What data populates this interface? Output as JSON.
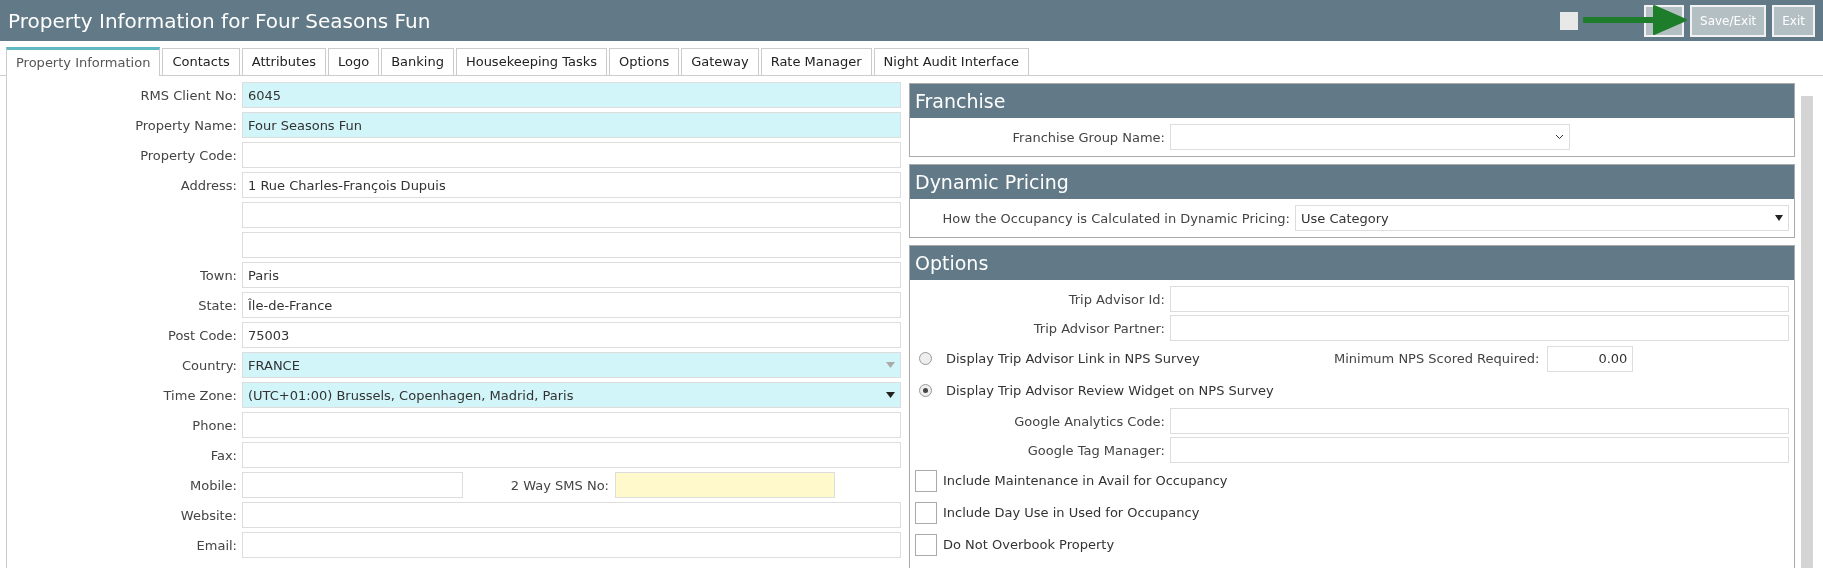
{
  "header": {
    "title": "Property Information for Four Seasons Fun",
    "inactive_checkbox": {
      "checked": false
    },
    "buttons": [
      {
        "label": "Save/Exit"
      },
      {
        "label": "Exit"
      }
    ]
  },
  "tabs": [
    {
      "label": "Property Information",
      "selected": true
    },
    {
      "label": "Contacts",
      "selected": false
    },
    {
      "label": "Attributes",
      "selected": false
    },
    {
      "label": "Logo",
      "selected": false
    },
    {
      "label": "Banking",
      "selected": false
    },
    {
      "label": "Housekeeping Tasks",
      "selected": false
    },
    {
      "label": "Options",
      "selected": false
    },
    {
      "label": "Gateway",
      "selected": false
    },
    {
      "label": "Rate Manager",
      "selected": false
    },
    {
      "label": "Night Audit Interface",
      "selected": false
    }
  ],
  "property_form": [
    {
      "label": "RMS Client No:",
      "value": "6045",
      "kind": "text",
      "color": "#d1f5f9"
    },
    {
      "label": "Property Name:",
      "value": "Four Seasons Fun",
      "kind": "text",
      "color": "#d1f5f9"
    },
    {
      "label": "Property Code:",
      "kind": "text"
    },
    {
      "label": "Address:",
      "value": "1 Rue Charles-François Dupuis",
      "kind": "text"
    },
    {
      "kind": "text"
    },
    {
      "kind": "text"
    },
    {
      "label": "Town:",
      "value": "Paris",
      "kind": "text"
    },
    {
      "label": "State:",
      "value": "Île-de-France",
      "kind": "text"
    },
    {
      "label": "Post Code:",
      "value": "75003",
      "kind": "text"
    },
    {
      "label": "Country:",
      "value": "FRANCE",
      "kind": "combo",
      "color": "#d1f5f9"
    },
    {
      "label": "Time Zone:",
      "value": "(UTC+01:00) Brussels, Copenhagen, Madrid, Paris",
      "kind": "select",
      "color": "#d1f5f9"
    },
    {
      "label": "Phone:",
      "kind": "text"
    },
    {
      "label": "Fax:",
      "kind": "text"
    },
    {
      "label": "Mobile:",
      "kind": "pair",
      "second": {
        "label": "2 Way SMS No:",
        "color": "#fff9cc"
      }
    },
    {
      "label": "Website:",
      "kind": "text"
    },
    {
      "label": "Email:",
      "kind": "text"
    }
  ],
  "franchise": {
    "title": "Franchise",
    "label": "Franchise Group Name:"
  },
  "dynamic_pricing": {
    "title": "Dynamic Pricing",
    "label": "How the Occupancy is Calculated in Dynamic Pricing:",
    "value": "Use Category"
  },
  "options": {
    "title": "Options",
    "items": [
      {
        "kind": "field",
        "label": "Trip Advisor Id:"
      },
      {
        "kind": "field",
        "label": "Trip Advisor Partner:"
      },
      {
        "kind": "radio",
        "label": "Display Trip Advisor Link in NPS Survey",
        "selected": false,
        "side_label": "Minimum NPS Scored Required:",
        "side_value": "0.00"
      },
      {
        "kind": "radio",
        "label": "Display Trip Advisor Review Widget on NPS Survey",
        "selected": true
      },
      {
        "kind": "field",
        "label": "Google Analytics Code:"
      },
      {
        "kind": "field",
        "label": "Google Tag Manager:"
      },
      {
        "kind": "checkbox",
        "label": "Include Maintenance in Avail for Occupancy",
        "checked": false
      },
      {
        "kind": "checkbox",
        "label": "Include Day Use in Used for Occupancy",
        "checked": false
      },
      {
        "kind": "checkbox",
        "label": "Do Not Overbook Property",
        "checked": false
      }
    ]
  }
}
